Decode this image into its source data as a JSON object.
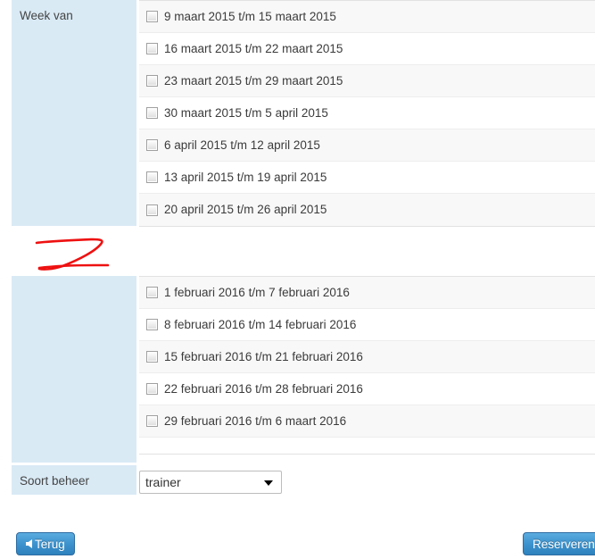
{
  "form": {
    "rows": [
      {
        "label": "Week van",
        "type": "checkbox-list",
        "options": [
          "9 maart 2015 t/m 15 maart 2015",
          "16 maart 2015 t/m 22 maart 2015",
          "23 maart 2015 t/m 29 maart 2015",
          "30 maart 2015 t/m 5 april 2015",
          "6 april 2015 t/m 12 april 2015",
          "13 april 2015 t/m 19 april 2015",
          "20 april 2015 t/m 26 april 2015"
        ]
      },
      {
        "label": "",
        "type": "checkbox-list",
        "options": [
          "1 februari 2016 t/m 7 februari 2016",
          "8 februari 2016 t/m 14 februari 2016",
          "15 februari 2016 t/m 21 februari 2016",
          "22 februari 2016 t/m 28 februari 2016",
          "29 februari 2016 t/m 6 maart 2016"
        ]
      },
      {
        "label": "Soort beheer",
        "type": "select",
        "value": "trainer",
        "options": [
          "trainer"
        ]
      }
    ]
  },
  "footer": {
    "back_label": "Terug",
    "reserve_label": "Reserveren"
  },
  "annotation": {
    "mark": "Z",
    "color": "#ee1111"
  },
  "colors": {
    "label_panel": "#d9eaf5",
    "row_odd": "#f8f8f8",
    "row_even": "#ffffff",
    "button_blue": "#3d93ce",
    "annotation_red": "#ee1111"
  }
}
